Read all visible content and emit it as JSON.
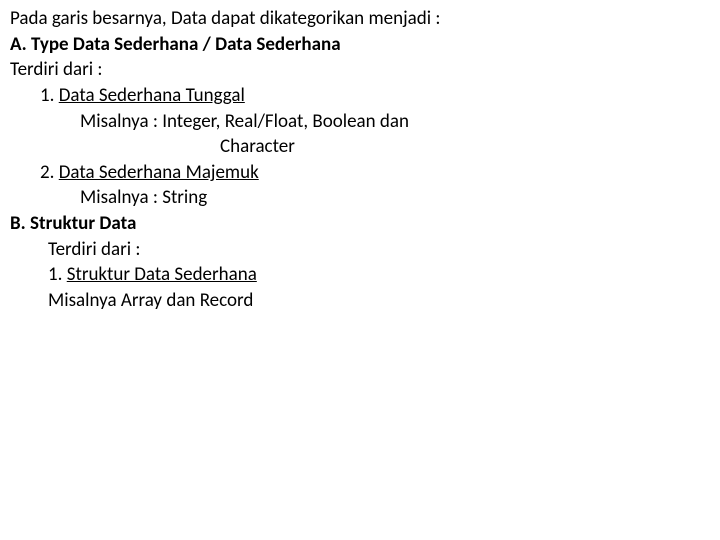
{
  "intro": "Pada garis besarnya, Data dapat dikategorikan menjadi :",
  "sectionA": {
    "heading": "A. Type Data Sederhana / Data Sederhana",
    "subheading": "Terdiri dari :",
    "item1": {
      "title": "1. Data Sederhana Tunggal",
      "detail_line1": "Misalnya : Integer, Real/Float, Boolean dan",
      "detail_line2": "Character"
    },
    "item2": {
      "title": "2. Data Sederhana Majemuk",
      "detail": "Misalnya : String"
    }
  },
  "sectionB": {
    "heading": "B. Struktur Data",
    "subheading": "Terdiri dari :",
    "item1": {
      "title": "1. Struktur Data Sederhana",
      "detail": "Misalnya Array dan Record"
    }
  }
}
